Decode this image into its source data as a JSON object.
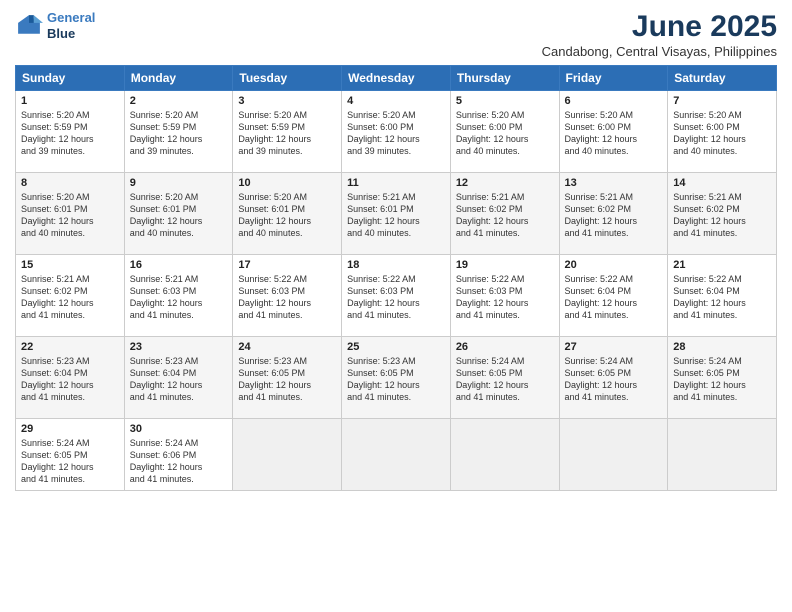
{
  "logo": {
    "line1": "General",
    "line2": "Blue"
  },
  "title": "June 2025",
  "subtitle": "Candabong, Central Visayas, Philippines",
  "days": [
    "Sunday",
    "Monday",
    "Tuesday",
    "Wednesday",
    "Thursday",
    "Friday",
    "Saturday"
  ],
  "weeks": [
    [
      {
        "day": 1,
        "sunrise": "5:20 AM",
        "sunset": "5:59 PM",
        "daylight": "12 hours and 39 minutes."
      },
      {
        "day": 2,
        "sunrise": "5:20 AM",
        "sunset": "5:59 PM",
        "daylight": "12 hours and 39 minutes."
      },
      {
        "day": 3,
        "sunrise": "5:20 AM",
        "sunset": "5:59 PM",
        "daylight": "12 hours and 39 minutes."
      },
      {
        "day": 4,
        "sunrise": "5:20 AM",
        "sunset": "6:00 PM",
        "daylight": "12 hours and 39 minutes."
      },
      {
        "day": 5,
        "sunrise": "5:20 AM",
        "sunset": "6:00 PM",
        "daylight": "12 hours and 40 minutes."
      },
      {
        "day": 6,
        "sunrise": "5:20 AM",
        "sunset": "6:00 PM",
        "daylight": "12 hours and 40 minutes."
      },
      {
        "day": 7,
        "sunrise": "5:20 AM",
        "sunset": "6:00 PM",
        "daylight": "12 hours and 40 minutes."
      }
    ],
    [
      {
        "day": 8,
        "sunrise": "5:20 AM",
        "sunset": "6:01 PM",
        "daylight": "12 hours and 40 minutes."
      },
      {
        "day": 9,
        "sunrise": "5:20 AM",
        "sunset": "6:01 PM",
        "daylight": "12 hours and 40 minutes."
      },
      {
        "day": 10,
        "sunrise": "5:20 AM",
        "sunset": "6:01 PM",
        "daylight": "12 hours and 40 minutes."
      },
      {
        "day": 11,
        "sunrise": "5:21 AM",
        "sunset": "6:01 PM",
        "daylight": "12 hours and 40 minutes."
      },
      {
        "day": 12,
        "sunrise": "5:21 AM",
        "sunset": "6:02 PM",
        "daylight": "12 hours and 41 minutes."
      },
      {
        "day": 13,
        "sunrise": "5:21 AM",
        "sunset": "6:02 PM",
        "daylight": "12 hours and 41 minutes."
      },
      {
        "day": 14,
        "sunrise": "5:21 AM",
        "sunset": "6:02 PM",
        "daylight": "12 hours and 41 minutes."
      }
    ],
    [
      {
        "day": 15,
        "sunrise": "5:21 AM",
        "sunset": "6:02 PM",
        "daylight": "12 hours and 41 minutes."
      },
      {
        "day": 16,
        "sunrise": "5:21 AM",
        "sunset": "6:03 PM",
        "daylight": "12 hours and 41 minutes."
      },
      {
        "day": 17,
        "sunrise": "5:22 AM",
        "sunset": "6:03 PM",
        "daylight": "12 hours and 41 minutes."
      },
      {
        "day": 18,
        "sunrise": "5:22 AM",
        "sunset": "6:03 PM",
        "daylight": "12 hours and 41 minutes."
      },
      {
        "day": 19,
        "sunrise": "5:22 AM",
        "sunset": "6:03 PM",
        "daylight": "12 hours and 41 minutes."
      },
      {
        "day": 20,
        "sunrise": "5:22 AM",
        "sunset": "6:04 PM",
        "daylight": "12 hours and 41 minutes."
      },
      {
        "day": 21,
        "sunrise": "5:22 AM",
        "sunset": "6:04 PM",
        "daylight": "12 hours and 41 minutes."
      }
    ],
    [
      {
        "day": 22,
        "sunrise": "5:23 AM",
        "sunset": "6:04 PM",
        "daylight": "12 hours and 41 minutes."
      },
      {
        "day": 23,
        "sunrise": "5:23 AM",
        "sunset": "6:04 PM",
        "daylight": "12 hours and 41 minutes."
      },
      {
        "day": 24,
        "sunrise": "5:23 AM",
        "sunset": "6:05 PM",
        "daylight": "12 hours and 41 minutes."
      },
      {
        "day": 25,
        "sunrise": "5:23 AM",
        "sunset": "6:05 PM",
        "daylight": "12 hours and 41 minutes."
      },
      {
        "day": 26,
        "sunrise": "5:24 AM",
        "sunset": "6:05 PM",
        "daylight": "12 hours and 41 minutes."
      },
      {
        "day": 27,
        "sunrise": "5:24 AM",
        "sunset": "6:05 PM",
        "daylight": "12 hours and 41 minutes."
      },
      {
        "day": 28,
        "sunrise": "5:24 AM",
        "sunset": "6:05 PM",
        "daylight": "12 hours and 41 minutes."
      }
    ],
    [
      {
        "day": 29,
        "sunrise": "5:24 AM",
        "sunset": "6:05 PM",
        "daylight": "12 hours and 41 minutes."
      },
      {
        "day": 30,
        "sunrise": "5:24 AM",
        "sunset": "6:06 PM",
        "daylight": "12 hours and 41 minutes."
      },
      null,
      null,
      null,
      null,
      null
    ]
  ]
}
